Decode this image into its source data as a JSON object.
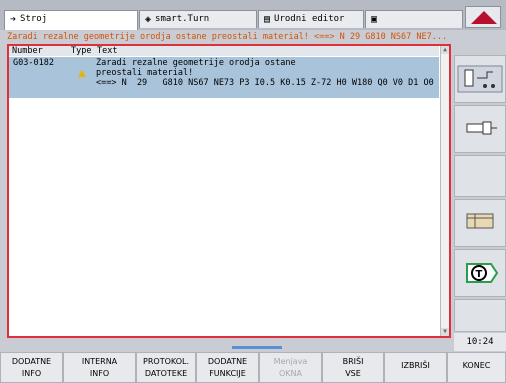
{
  "tabs": [
    {
      "label": "Stroj",
      "icon": "arrow-right-icon",
      "active": true
    },
    {
      "label": "smart.Turn",
      "icon": "diamond-arrow-icon",
      "active": false
    },
    {
      "label": "Urodni editor",
      "icon": "edit-icon",
      "active": false
    },
    {
      "label": "",
      "icon": "save-icon",
      "active": false
    }
  ],
  "status_message": "Zaradi rezalne geometrije orodja ostane preostali material! <==> N  29   G810 NS67 NE7...",
  "table": {
    "columns": [
      "Number",
      "Type",
      "Text"
    ],
    "rows": [
      {
        "number": "G03-0182",
        "type": "warning",
        "text_line1": "Zaradi rezalne geometrije orodja ostane",
        "text_line2": "preostali material!",
        "text_line3": "<==> N  29   G810 NS67 NE73 P3 I0.5 K0.15 Z-72 H0 W180 Q0 V0 D1 O0"
      }
    ]
  },
  "clock": "10:24",
  "softkeys": [
    {
      "line1": "DODATNE",
      "line2": "INFO",
      "enabled": true
    },
    {
      "line1": "INTERNA",
      "line2": "INFO",
      "enabled": true
    },
    {
      "line1": "PROTOKOL.",
      "line2": "DATOTEKE",
      "enabled": true
    },
    {
      "line1": "DODATNE",
      "line2": "FUNKCIJE",
      "enabled": true
    },
    {
      "line1": "Menjava",
      "line2": "OKNA",
      "enabled": false
    },
    {
      "line1": "BRIŠI",
      "line2": "VSE",
      "enabled": true
    },
    {
      "line1": "IZBRIŠI",
      "line2": "",
      "enabled": true
    },
    {
      "line1": "KONEC",
      "line2": "",
      "enabled": true
    }
  ],
  "colors": {
    "accent_red": "#de2f3d",
    "selected_row": "#a8c3da",
    "warning_text": "#d3520a",
    "logo": "#b90f2f"
  }
}
